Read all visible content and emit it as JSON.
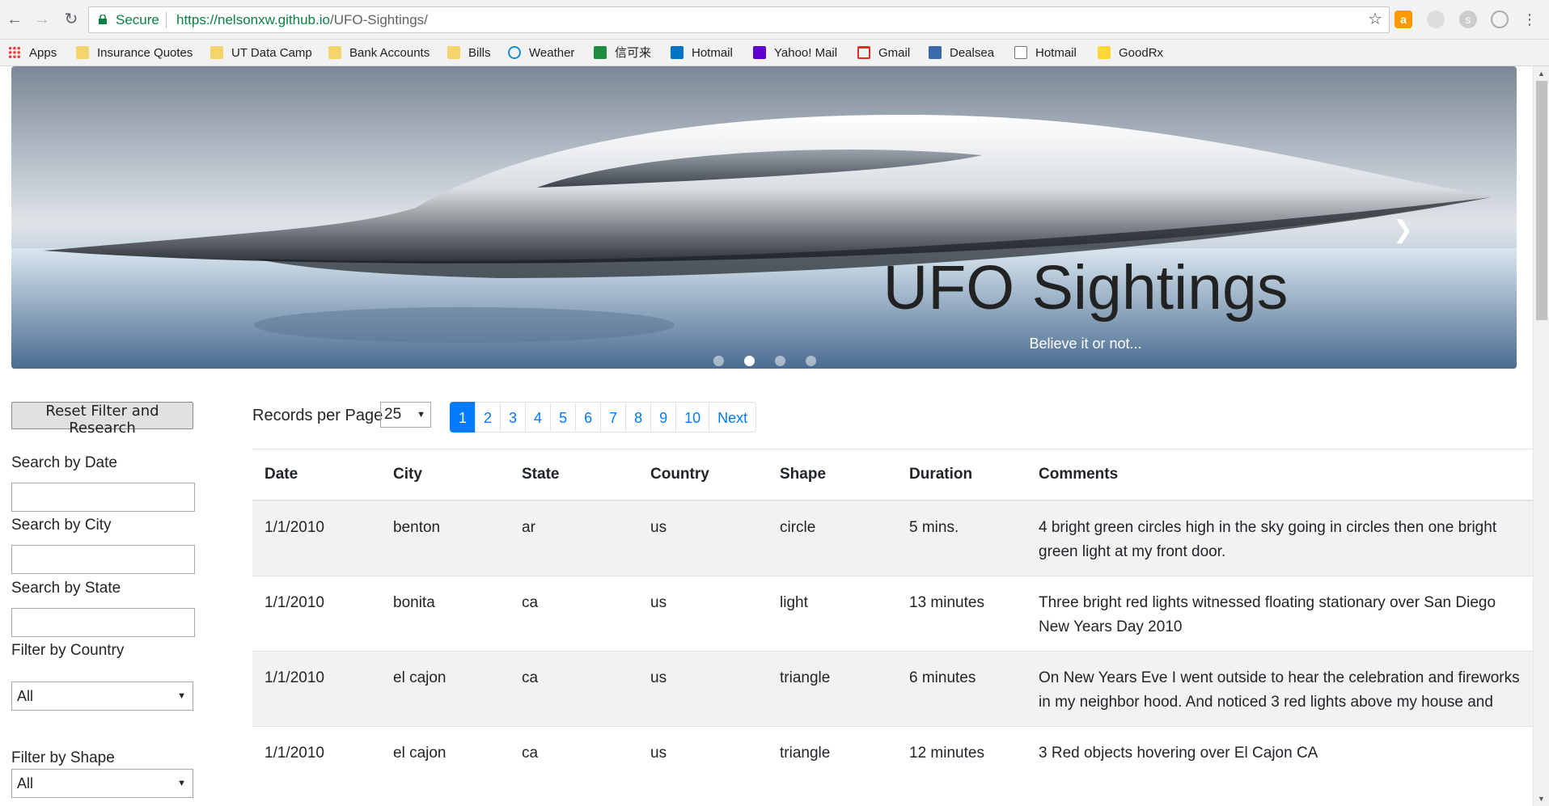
{
  "browser": {
    "secure_label": "Secure",
    "url_host": "https://nelsonxw.github.io",
    "url_path": "/UFO-Sightings/"
  },
  "bookmarks": [
    {
      "label": "Apps"
    },
    {
      "label": "Insurance Quotes"
    },
    {
      "label": "UT Data Camp"
    },
    {
      "label": "Bank Accounts"
    },
    {
      "label": "Bills"
    },
    {
      "label": "Weather"
    },
    {
      "label": "信可来"
    },
    {
      "label": "Hotmail"
    },
    {
      "label": "Yahoo! Mail"
    },
    {
      "label": "Gmail"
    },
    {
      "label": "Dealsea"
    },
    {
      "label": "Hotmail"
    },
    {
      "label": "GoodRx"
    }
  ],
  "hero": {
    "title": "UFO Sightings",
    "subtitle": "Believe it or not...",
    "active_slide": 2,
    "slide_count": 4
  },
  "sidebar": {
    "reset_label": "Reset Filter and Research",
    "search_date_label": "Search by Date",
    "search_city_label": "Search by City",
    "search_state_label": "Search by State",
    "filter_country_label": "Filter by Country",
    "filter_country_value": "All",
    "filter_shape_label": "Filter by Shape",
    "filter_shape_value": "All"
  },
  "records": {
    "label": "Records per Page",
    "value": "25"
  },
  "pagination": {
    "pages": [
      "1",
      "2",
      "3",
      "4",
      "5",
      "6",
      "7",
      "8",
      "9",
      "10"
    ],
    "active": "1",
    "next_label": "Next"
  },
  "table": {
    "headers": [
      "Date",
      "City",
      "State",
      "Country",
      "Shape",
      "Duration",
      "Comments"
    ],
    "rows": [
      [
        "1/1/2010",
        "benton",
        "ar",
        "us",
        "circle",
        "5 mins.",
        "4 bright green circles high in the sky going in circles then one bright green light at my front door."
      ],
      [
        "1/1/2010",
        "bonita",
        "ca",
        "us",
        "light",
        "13 minutes",
        "Three bright red lights witnessed floating stationary over San Diego New Years Day 2010"
      ],
      [
        "1/1/2010",
        "el cajon",
        "ca",
        "us",
        "triangle",
        "6 minutes",
        "On New Years Eve I went outside to hear the celebration and fireworks in my neighbor hood. And noticed 3 red lights above my house and"
      ],
      [
        "1/1/2010",
        "el cajon",
        "ca",
        "us",
        "triangle",
        "12 minutes",
        "3 Red objects hovering over El Cajon CA"
      ]
    ]
  }
}
